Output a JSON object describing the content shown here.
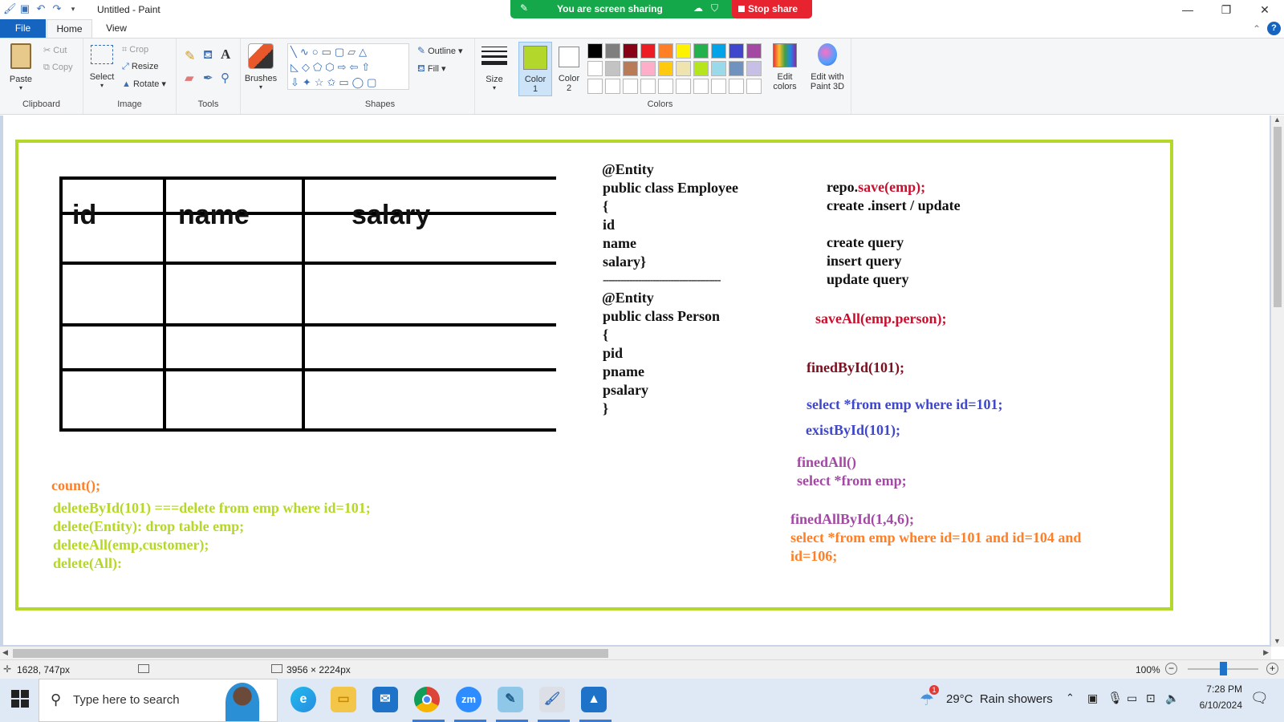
{
  "window": {
    "title": "Untitled - Paint",
    "controls": [
      "—",
      "❐",
      "✕"
    ]
  },
  "share_bar": {
    "text": "You are screen sharing",
    "stop_label": "Stop share"
  },
  "tabs": [
    "File",
    "Home",
    "View"
  ],
  "ribbon": {
    "clipboard": {
      "label": "Clipboard",
      "paste": "Paste",
      "cut": "Cut",
      "copy": "Copy"
    },
    "image": {
      "label": "Image",
      "select": "Select",
      "crop": "Crop",
      "resize": "Resize",
      "rotate": "Rotate"
    },
    "tools": {
      "label": "Tools"
    },
    "brushes": {
      "label": "Brushes"
    },
    "shapes": {
      "label": "Shapes",
      "outline": "Outline",
      "fill": "Fill"
    },
    "size": {
      "label": "Size"
    },
    "color1": {
      "label_a": "Color",
      "label_b": "1",
      "value": "#b3d82b"
    },
    "color2": {
      "label_a": "Color",
      "label_b": "2",
      "value": "#ffffff"
    },
    "colors": {
      "label": "Colors"
    },
    "edit_colors": {
      "label_a": "Edit",
      "label_b": "colors"
    },
    "paint3d": {
      "label_a": "Edit with",
      "label_b": "Paint 3D"
    },
    "palette_row1": [
      "#000000",
      "#7f7f7f",
      "#880015",
      "#ed1c24",
      "#ff7f27",
      "#fff200",
      "#22b14c",
      "#00a2e8",
      "#3f48cc",
      "#a349a4"
    ],
    "palette_row2": [
      "#ffffff",
      "#c3c3c3",
      "#b97a57",
      "#ffaec9",
      "#ffc90e",
      "#efe4b0",
      "#b5e61d",
      "#99d9ea",
      "#7092be",
      "#c8bfe7"
    ]
  },
  "table": {
    "headers": [
      "id",
      "name",
      "salary"
    ]
  },
  "canvas_text": {
    "employee": [
      "@Entity",
      "public class Employee",
      "{",
      "id",
      "name",
      "salary}"
    ],
    "divider": "----------------------------------------",
    "person": [
      "@Entity",
      "public class Person",
      "{",
      "pid",
      "pname",
      "psalary",
      "}"
    ],
    "repo_save_a": "repo.",
    "repo_save_b": "save(emp);",
    "create_insert": "create .insert / update",
    "queries": [
      "create query",
      "insert query",
      "update query"
    ],
    "save_all": "saveAll(emp.person);",
    "find_by_id": "finedById(101);",
    "select_id": "select *from emp where id=101;",
    "exist_by_id": "existById(101);",
    "find_all": "finedAll()",
    "select_all": "select *from emp;",
    "find_all_by_id": "finedAllById(1,4,6);",
    "select_multi_1": "select *from emp where id=101 and id=104 and",
    "select_multi_2": "id=106;",
    "count": "count();",
    "deletes": [
      "deleteById(101) ===delete from emp where id=101;",
      "delete(Entity): drop table emp;",
      "deleteAll(emp,customer);",
      "delete(All):"
    ],
    "colors": {
      "black": "#111111",
      "dark_red": "#7a1020",
      "red": "#c8102e",
      "blue": "#3f48cc",
      "purple": "#a349a4",
      "orange": "#ff7f27",
      "lime": "#b5d828"
    }
  },
  "status": {
    "cursor_pos": "1628, 747px",
    "image_size": "3956 × 2224px",
    "zoom": "100%"
  },
  "taskbar": {
    "search_placeholder": "Type here to search",
    "weather": "29°C  Rain showers",
    "weather_badge": "1",
    "time": "7:28 PM",
    "date": "6/10/2024"
  }
}
